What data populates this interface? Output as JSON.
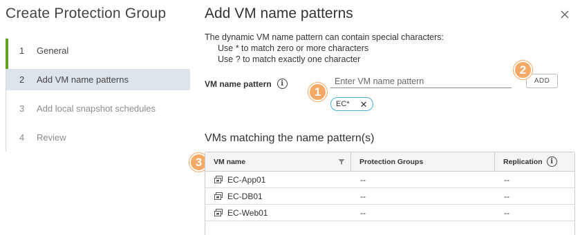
{
  "wizard": {
    "title": "Create Protection Group",
    "steps": [
      {
        "num": "1",
        "label": "General"
      },
      {
        "num": "2",
        "label": "Add VM name patterns"
      },
      {
        "num": "3",
        "label": "Add local snapshot schedules"
      },
      {
        "num": "4",
        "label": "Review"
      }
    ]
  },
  "main": {
    "title": "Add VM name patterns",
    "description": {
      "line1": "The dynamic VM name pattern can contain special characters:",
      "line2": "Use * to match zero or more characters",
      "line3": "Use ? to match exactly one character"
    },
    "pattern_label": "VM name pattern",
    "pattern_input": {
      "value": "",
      "placeholder": "Enter VM name pattern"
    },
    "add_button": "ADD",
    "chips": [
      "EC*"
    ],
    "section_title": "VMs matching the name pattern(s)",
    "table": {
      "headers": {
        "vm_name": "VM name",
        "protection_groups": "Protection Groups",
        "replication": "Replication"
      },
      "rows": [
        {
          "name": "EC-App01",
          "groups": "--",
          "replication": "--"
        },
        {
          "name": "EC-DB01",
          "groups": "--",
          "replication": "--"
        },
        {
          "name": "EC-Web01",
          "groups": "--",
          "replication": "--"
        }
      ]
    }
  },
  "badges": [
    "1",
    "2",
    "3"
  ],
  "colors": {
    "accent_green": "#62a420",
    "badge_orange": "#f4a964",
    "chip_border": "#49afd9",
    "active_step": "#dde5ec"
  }
}
